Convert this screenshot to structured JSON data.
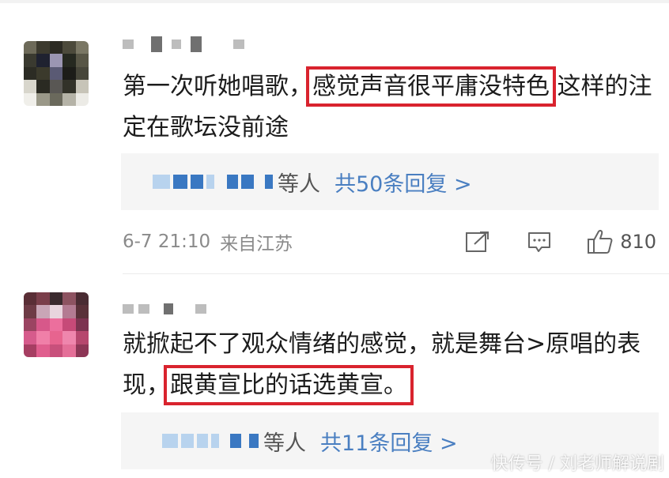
{
  "comments": [
    {
      "text_before": "第一次听她唱歌，",
      "text_highlight": "感觉声音很平庸没特色",
      "text_after": "  这样的注定在歌坛没前途",
      "reply": {
        "suffix": "等人",
        "count_label": "共50条回复 >"
      },
      "meta": {
        "time": "6-7 21:10",
        "source": "来自江苏",
        "likes": "810"
      }
    },
    {
      "text_before": "就掀起不了观众情绪的感觉，就是舞台>原唱的表现，",
      "text_highlight": "跟黄宣比的话选黄宣。",
      "text_after": "",
      "reply": {
        "suffix": "等人",
        "count_label": "共11条回复 >"
      }
    }
  ],
  "watermark": "快传号 / 刘老师解说剧",
  "icons": [
    "share-icon",
    "comment-icon",
    "like-icon"
  ],
  "colors": {
    "highlight_box": "#d9232e",
    "link_blue": "#4a7fc1",
    "reply_bg": "#f5f5f5"
  }
}
